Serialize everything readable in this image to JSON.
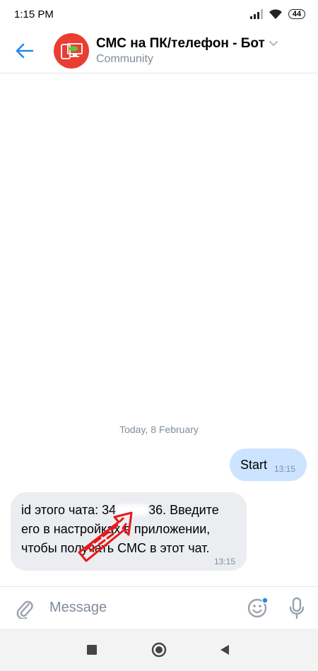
{
  "status_bar": {
    "time": "1:15 PM",
    "battery": "44"
  },
  "header": {
    "title": "СМС на ПК/телефон - Бот",
    "subtitle": "Community",
    "avatar_color": "#ea3e33",
    "avatar_icon": "sms-devices-icon"
  },
  "conversation": {
    "date_separator": "Today, 8 February",
    "outgoing": {
      "text": "Start",
      "time": "13:15"
    },
    "incoming": {
      "line1_before_redaction": "id этого чата: 34",
      "line1_after_redaction": "36. Введите",
      "line2": "его в настройках в приложении,",
      "line3": "чтобы получать СМС в этот чат.",
      "time": "13:15"
    },
    "annotation_color": "#e8191c"
  },
  "composer": {
    "placeholder": "Message"
  },
  "colors": {
    "accent": "#2688eb",
    "outgoing_bubble": "#cce4ff",
    "incoming_bubble": "#ebedf0"
  }
}
